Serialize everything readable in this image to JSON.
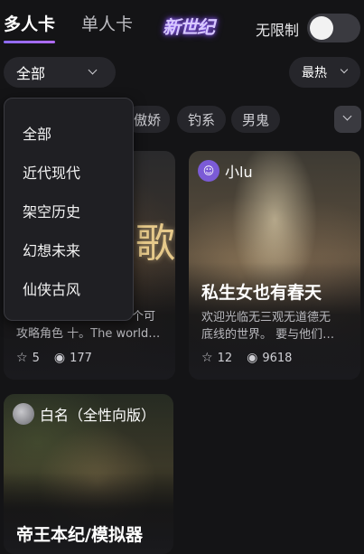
{
  "tabs": {
    "multi": "多人卡",
    "single": "单人卡"
  },
  "logo": "新世纪",
  "unlimited": {
    "label": "无限制",
    "enabled": false
  },
  "filter": {
    "category_selected": "全部",
    "sort_selected": "最热"
  },
  "tags": [
    "傲娇",
    "钓系",
    "男鬼"
  ],
  "dropdown": {
    "options": [
      "全部",
      "近代现代",
      "架空历史",
      "幻想未来",
      "仙侠古风"
    ]
  },
  "cards": [
    {
      "author": "",
      "title": "",
      "desc_line1": "个可",
      "desc_line2": "攻略角色 十。The world…",
      "poster_text": "歌",
      "stars": "5",
      "views": "177"
    },
    {
      "author": "小lu",
      "title": "私生女也有春天",
      "desc_line1": "欢迎光临无三观无道德无",
      "desc_line2": "底线的世界。 要与他们…",
      "stars": "12",
      "views": "9618"
    },
    {
      "author": "白名（全性向版）",
      "title": "帝王本纪/模拟器"
    }
  ],
  "icons": {
    "star": "star-icon",
    "views": "eye-icon",
    "chevron": "chevron-down-icon"
  },
  "colors": {
    "accent": "#8d6bff",
    "background": "#141416",
    "surface": "#26262b"
  }
}
